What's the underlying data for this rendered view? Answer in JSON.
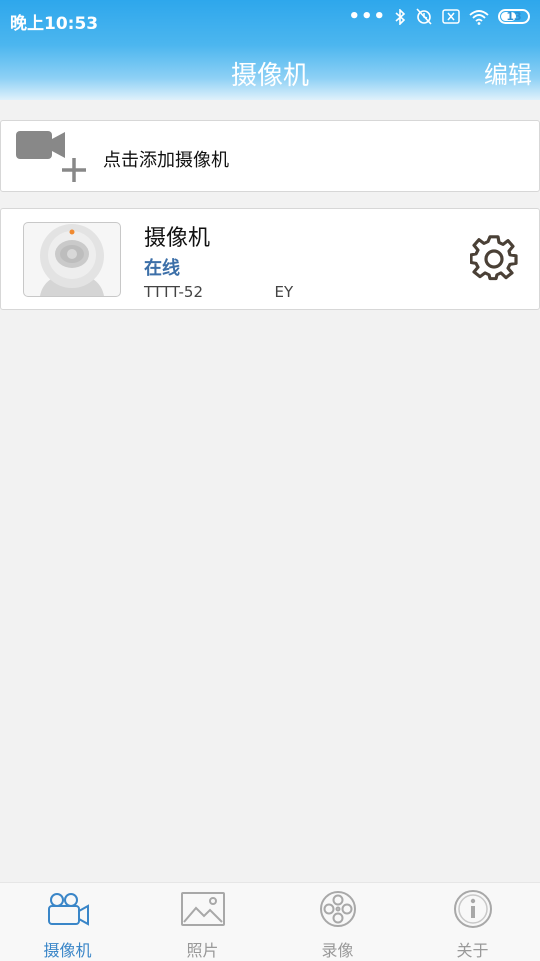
{
  "status_bar": {
    "time": "晚上10:53",
    "dots": "•••",
    "icons": [
      "bluetooth-icon",
      "alarm-off-icon",
      "sim-off-icon",
      "wifi-icon"
    ],
    "battery": "13"
  },
  "header": {
    "title": "摄像机",
    "edit_label": "编辑"
  },
  "add_camera": {
    "label": "点击添加摄像机"
  },
  "camera": {
    "name": "摄像机",
    "status": "在线",
    "uid": "TTTT-52               EY"
  },
  "tabs": [
    {
      "label": "摄像机",
      "icon": "video-camera-icon",
      "active": true
    },
    {
      "label": "照片",
      "icon": "picture-icon",
      "active": false
    },
    {
      "label": "录像",
      "icon": "film-reel-icon",
      "active": false
    },
    {
      "label": "关于",
      "icon": "info-icon",
      "active": false
    }
  ],
  "colors": {
    "header_blue": "#2ea7ec",
    "active_tab": "#3a86c8",
    "status_online": "#3c6fa8",
    "inactive_tab": "#999999"
  }
}
